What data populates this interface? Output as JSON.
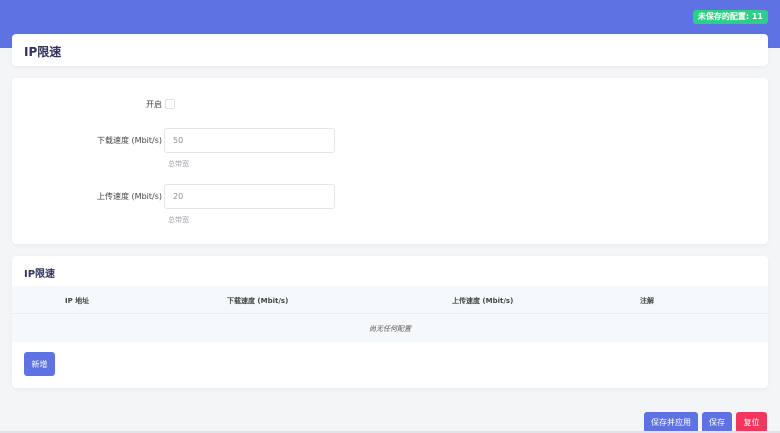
{
  "header": {
    "unsaved_badge": "未保存的配置: 11"
  },
  "page": {
    "title": "IP限速"
  },
  "form": {
    "enable_label": "开启",
    "enable_checked": false,
    "download_label": "下载速度 (Mbit/s)",
    "download_value": "50",
    "download_hint": "总带宽",
    "upload_label": "上传速度 (Mbit/s)",
    "upload_value": "20",
    "upload_hint": "总带宽"
  },
  "table": {
    "title": "IP限速",
    "columns": [
      "IP 地址",
      "下载速度 (Mbit/s)",
      "上传速度 (Mbit/s)",
      "注解"
    ],
    "empty_text": "尚无任何配置",
    "add_label": "新增"
  },
  "actions": {
    "save_apply": "保存并应用",
    "save": "保存",
    "reset": "复位"
  },
  "colors": {
    "primary": "#5e72e4",
    "success": "#2dce89",
    "danger": "#f5365c"
  }
}
